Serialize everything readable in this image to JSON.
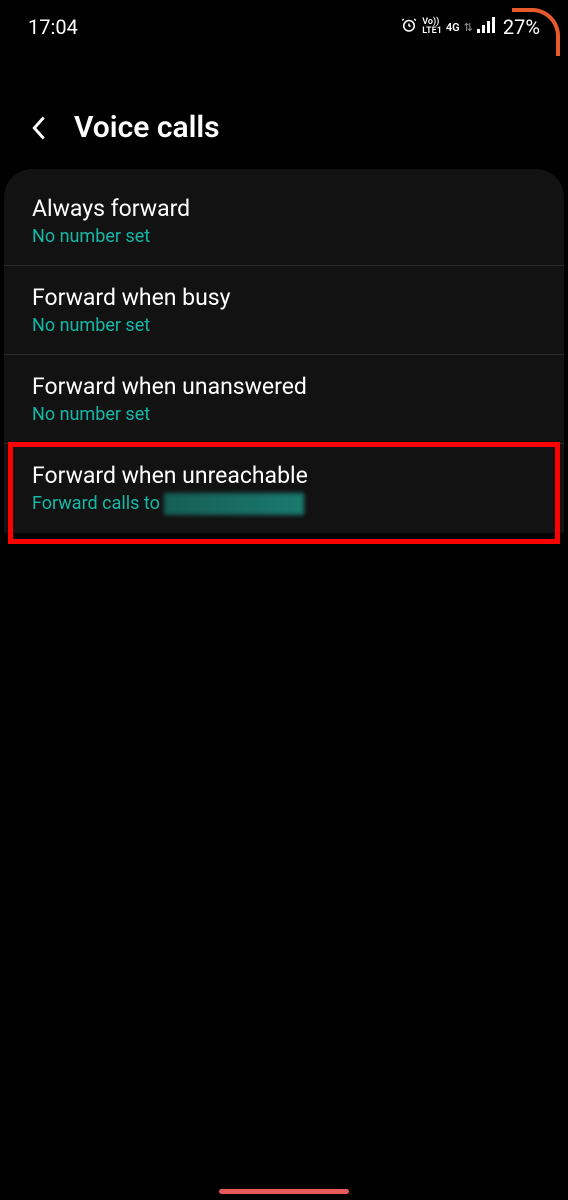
{
  "statusBar": {
    "time": "17:04",
    "battery": "27%",
    "volteTop": "Vo))",
    "volteBottom": "LTE1",
    "network": "4G"
  },
  "header": {
    "title": "Voice calls"
  },
  "settings": {
    "items": [
      {
        "title": "Always forward",
        "subtitle": "No number set"
      },
      {
        "title": "Forward when busy",
        "subtitle": "No number set"
      },
      {
        "title": "Forward when unanswered",
        "subtitle": "No number set"
      },
      {
        "title": "Forward when unreachable",
        "subtitle": "Forward calls to"
      }
    ]
  }
}
